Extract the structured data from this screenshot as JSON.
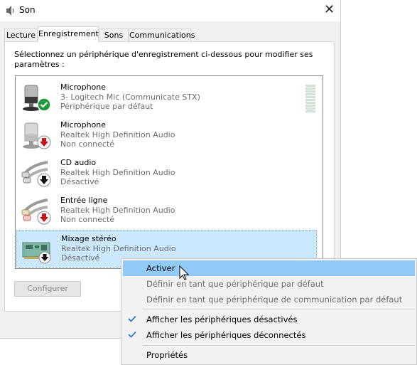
{
  "window": {
    "title": "Son",
    "close_symbol": "✕"
  },
  "tabs": [
    {
      "label": "Lecture"
    },
    {
      "label": "Enregistrement",
      "active": true
    },
    {
      "label": "Sons"
    },
    {
      "label": "Communications"
    }
  ],
  "instructions": "Sélectionnez un périphérique d'enregistrement ci-dessous pour modifier ses paramètres :",
  "devices": [
    {
      "name": "Microphone",
      "line1": "3- Logitech Mic (Communicate STX)",
      "line2": "Périphérique par défaut",
      "icon": "microphone-icon",
      "status_icon": "green-check-icon"
    },
    {
      "name": "Microphone",
      "line1": "Realtek High Definition Audio",
      "line2": "Non connecté",
      "icon": "microphone-icon",
      "status_icon": "red-down-arrow-icon"
    },
    {
      "name": "CD audio",
      "line1": "Realtek High Definition Audio",
      "line2": "Désactivé",
      "icon": "audio-cable-icon",
      "status_icon": "black-down-arrow-icon"
    },
    {
      "name": "Entrée ligne",
      "line1": "Realtek High Definition Audio",
      "line2": "Non connecté",
      "icon": "audio-cable-icon",
      "status_icon": "red-down-arrow-icon"
    },
    {
      "name": "Mixage stéréo",
      "line1": "Realtek High Definition Audio",
      "line2": "Désactivé",
      "icon": "sound-card-icon",
      "status_icon": "black-down-arrow-icon",
      "selected": true
    }
  ],
  "buttons": {
    "configure": "Configurer"
  },
  "context_menu": {
    "items": [
      {
        "label": "Activer",
        "highlighted": true
      },
      {
        "label": "Définir en tant que périphérique par défaut",
        "disabled": true
      },
      {
        "label": "Définir en tant que périphérique de communication par défaut",
        "disabled": true
      },
      {
        "label": "Afficher les périphériques désactivés",
        "checked": true
      },
      {
        "label": "Afficher les périphériques déconnectés",
        "checked": true
      },
      {
        "label": "Propriétés"
      }
    ]
  },
  "colors": {
    "selection": "#cce8ff",
    "menu_highlight": "#91c9f7",
    "check_blue": "#2e7bcf",
    "ok_green": "#1e9a3c",
    "down_red": "#c8161d"
  }
}
